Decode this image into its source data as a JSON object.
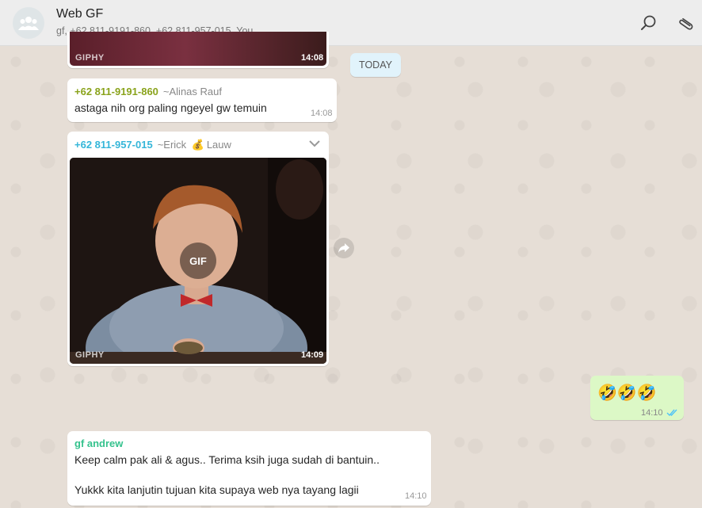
{
  "chat": {
    "title": "Web GF",
    "participants": "gf, +62 811-9191-860, +62 811-957-015, You"
  },
  "date_divider": "TODAY",
  "messages": [
    {
      "type": "gif",
      "giphy": "GIPHY",
      "time": "14:08"
    },
    {
      "type": "text",
      "sender": "+62 811-9191-860",
      "alias": "~Alinas Rauf",
      "text": "astaga nih org paling ngeyel gw temuin",
      "time": "14:08",
      "sender_color": "#8aa31c"
    },
    {
      "type": "gif",
      "sender": "+62 811-957-015",
      "alias_prefix": "~Erick",
      "alias_emoji": "💰",
      "alias_suffix": "Lauw",
      "gif_label": "GIF",
      "giphy": "GIPHY",
      "time": "14:09",
      "sender_color": "#35b6d9"
    },
    {
      "type": "text",
      "direction": "outgoing",
      "text": "🤣🤣🤣",
      "time": "14:10",
      "status_icon": "double-check-icon",
      "check_color": "#4fc3f7"
    },
    {
      "type": "text",
      "sender": "gf andrew",
      "line1": "Keep calm pak ali & agus.. Terima ksih juga sudah di bantuin..",
      "line2": "Yukkk kita lanjutin tujuan kita supaya web nya tayang lagii",
      "time": "14:10",
      "sender_color": "#35c28d"
    }
  ]
}
